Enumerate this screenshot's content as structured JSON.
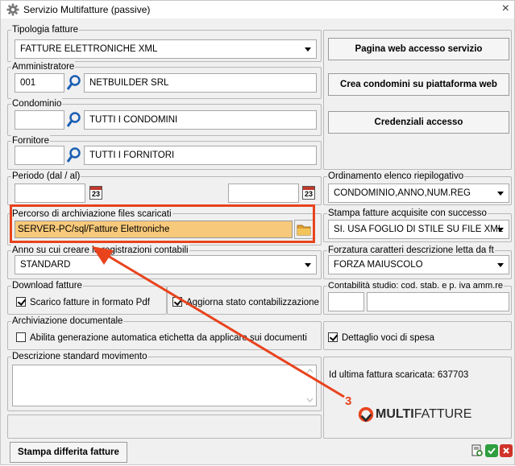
{
  "window": {
    "title": "Servizio Multifatture (passive)",
    "close_label": "×"
  },
  "tipologia": {
    "legend": "Tipologia fatture",
    "value": "FATTURE ELETTRONICHE XML"
  },
  "amministratore": {
    "legend": "Amministratore",
    "code": "001",
    "name": "NETBUILDER SRL"
  },
  "condominio": {
    "legend": "Condominio",
    "code": "",
    "name": "TUTTI I CONDOMINI"
  },
  "fornitore": {
    "legend": "Fornitore",
    "code": "",
    "name": "TUTTI I FORNITORI"
  },
  "periodo": {
    "legend": "Periodo (dal / al)",
    "from": "",
    "to": "",
    "calendar_day": "23"
  },
  "percorso": {
    "legend": "Percorso di archiviazione files scaricati",
    "value": "SERVER-PC/sql/Fatture Elettroniche"
  },
  "anno": {
    "legend": "Anno su cui creare le registrazioni contabili",
    "value": "STANDARD"
  },
  "download": {
    "legend": "Download fatture",
    "check_pdf": "Scarico fatture in formato Pdf",
    "check_stato": "Aggiorna stato contabilizzazione"
  },
  "archiviazione": {
    "legend": "Archiviazione documentale",
    "check_label": "Abilita generazione automatica etichetta da applicare sui documenti",
    "check_dettaglio": "Dettaglio voci di spesa"
  },
  "descrizione": {
    "legend": "Descrizione standard movimento",
    "value": ""
  },
  "buttons": {
    "pagina_web": "Pagina web accesso servizio",
    "crea_condomini": "Crea condomini su piattaforma web",
    "credenziali": "Credenziali accesso",
    "stampa_differita": "Stampa differita fatture"
  },
  "ordinamento": {
    "legend": "Ordinamento elenco riepilogativo",
    "value": "CONDOMINIO,ANNO,NUM.REG"
  },
  "stampa_fatture": {
    "legend": "Stampa fatture acquisite con successo",
    "value": "SI. USA FOGLIO DI STILE SU FILE XML"
  },
  "forzatura": {
    "legend": "Forzatura caratteri descrizione letta da ft",
    "value": "FORZA MAIUSCOLO"
  },
  "contabilita": {
    "legend": "Contabilità studio: cod. stab. e  p. iva amm.re",
    "cod": "",
    "piva": ""
  },
  "ultima_fattura": {
    "label": "Id ultima fattura scaricata: 637703"
  },
  "annotation": {
    "step": "3"
  },
  "logo": {
    "part1": "MULTI",
    "part2": "FATTURE"
  },
  "colors": {
    "highlight": "#f7c97a",
    "annotation": "#e8431d"
  }
}
